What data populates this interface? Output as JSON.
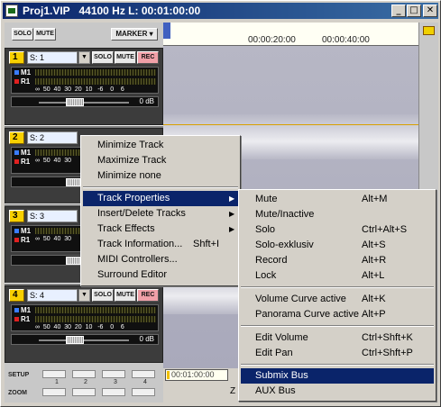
{
  "window": {
    "title": "Proj1.VIP   44100 Hz L: 00:01:00:00",
    "min_glyph": "_",
    "max_glyph": "□",
    "close_glyph": "✕"
  },
  "top_controls": {
    "solo": "SOLO",
    "mute": "MUTE",
    "marker": "MARKER ▾"
  },
  "tracks": [
    {
      "num": "1",
      "name": "S: 1",
      "solo": "SOLO",
      "mute": "MUTE",
      "rec": "REC",
      "m_label": "M1",
      "r_label": "R1",
      "scale": "∞  50  40  30  20  10   -6    0    6",
      "db": "0 dB"
    },
    {
      "num": "2",
      "name": "S: 2",
      "m_label": "M1",
      "r_label": "R1",
      "scale": "∞  50  40  30"
    },
    {
      "num": "3",
      "name": "S: 3",
      "m_label": "M1",
      "r_label": "R1",
      "scale": "∞  50  40  30"
    },
    {
      "num": "4",
      "name": "S: 4",
      "solo": "SOLO",
      "mute": "MUTE",
      "rec": "REC",
      "m_label": "M1",
      "r_label": "R1",
      "scale": "∞  50  40  30  20  10   -6    0    6",
      "db": "0 dB"
    }
  ],
  "timeline": {
    "ticks": [
      "00:00:20:00",
      "00:00:40:00"
    ],
    "position": "00:01:00:00",
    "status_letter": "Z"
  },
  "bottom": {
    "setup": "SETUP",
    "zoom": "ZOOM",
    "slot_numbers": [
      "1",
      "2",
      "3",
      "4"
    ]
  },
  "menu_main": {
    "items": [
      {
        "label": "Minimize Track"
      },
      {
        "label": "Maximize Track"
      },
      {
        "label": "Minimize none"
      },
      {
        "label": "Track Properties",
        "sub": "▶"
      },
      {
        "label": "Insert/Delete Tracks",
        "sub": "▶"
      },
      {
        "label": "Track Effects",
        "sub": "▶"
      },
      {
        "label": "Track Information...",
        "shortcut": "Shft+I"
      },
      {
        "label": "MIDI Controllers..."
      },
      {
        "label": "Surround Editor"
      }
    ]
  },
  "menu_sub": {
    "items": [
      {
        "label": "Mute",
        "shortcut": "Alt+M"
      },
      {
        "label": "Mute/Inactive",
        "shortcut": ""
      },
      {
        "label": "Solo",
        "shortcut": "Ctrl+Alt+S"
      },
      {
        "label": "Solo-exklusiv",
        "shortcut": "Alt+S"
      },
      {
        "label": "Record",
        "shortcut": "Alt+R"
      },
      {
        "label": "Lock",
        "shortcut": "Alt+L"
      },
      {
        "label": "Volume Curve active",
        "shortcut": "Alt+K"
      },
      {
        "label": "Panorama Curve active",
        "shortcut": "Alt+P"
      },
      {
        "label": "Edit Volume",
        "shortcut": "Ctrl+Shft+K"
      },
      {
        "label": "Edit Pan",
        "shortcut": "Ctrl+Shft+P"
      },
      {
        "label": "Submix Bus",
        "shortcut": ""
      },
      {
        "label": "AUX Bus",
        "shortcut": ""
      }
    ]
  },
  "colors": {
    "title_bar": "#0a246a",
    "highlight": "#0a246a",
    "track_number": "#f8d000"
  }
}
